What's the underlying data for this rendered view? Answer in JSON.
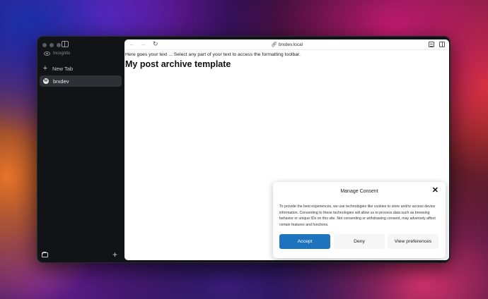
{
  "sidebar": {
    "incognito_label": "Incognito",
    "new_tab_label": "New Tab",
    "tabs": [
      {
        "label": "brxdev",
        "icon": "wordpress-icon"
      }
    ]
  },
  "toolbar": {
    "url": "brxdev.local",
    "back_icon": "←",
    "forward_icon": "→",
    "reload_icon": "↻"
  },
  "page": {
    "intro_text": "Here goes your text ... Select any part of your text to access the formatting toolbar.",
    "title": "My post archive template"
  },
  "consent": {
    "title": "Manage Consent",
    "close_icon": "✕",
    "body": "To provide the best experiences, we use technologies like cookies to store and/or access device information. Consenting to these technologies will allow us to process data such as browsing behavior or unique IDs on this site. Not consenting or withdrawing consent, may adversely affect certain features and functions.",
    "accept_label": "Accept",
    "deny_label": "Deny",
    "preferences_label": "View preferences",
    "accent_color": "#1e73be"
  }
}
